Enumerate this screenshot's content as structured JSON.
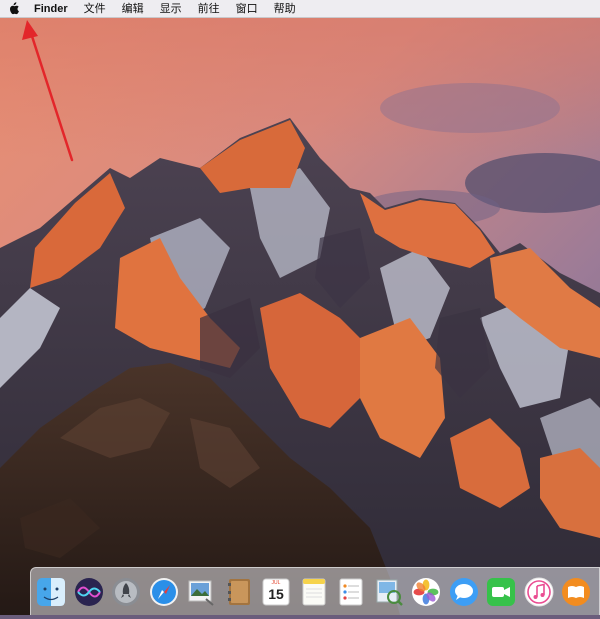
{
  "menubar": {
    "apple_icon": "apple-icon",
    "items": [
      "Finder",
      "文件",
      "编辑",
      "显示",
      "前往",
      "窗口",
      "帮助"
    ]
  },
  "desktop": {
    "wallpaper": "macOS Sierra mountain sunset",
    "colors": {
      "sky_top": "#e28d73",
      "sky_mid": "#c07a86",
      "sky_right": "#6e6a8e",
      "peak_lit": "#e2733f",
      "rock": "#3b2c26"
    }
  },
  "annotation": {
    "arrow_color": "#e3262a",
    "points_to": "apple-menu"
  },
  "dock": {
    "calendar": {
      "month": "JUL",
      "day": "15"
    },
    "apps": [
      "finder",
      "siri",
      "launchpad",
      "safari",
      "photo-browser",
      "contacts",
      "calendar",
      "notes",
      "reminders",
      "preview",
      "photos",
      "messages",
      "facetime",
      "itunes",
      "ibooks"
    ]
  }
}
